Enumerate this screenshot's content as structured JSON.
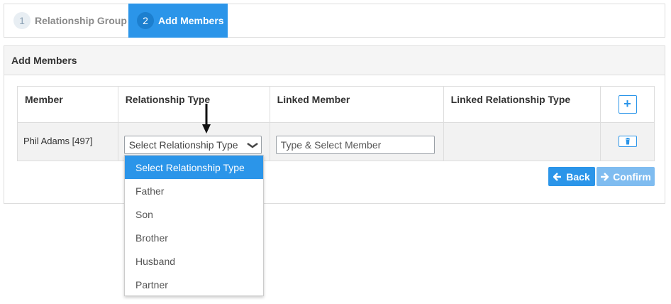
{
  "stepper": {
    "steps": [
      {
        "number": "1",
        "label": "Relationship Group"
      },
      {
        "number": "2",
        "label": "Add Members"
      }
    ]
  },
  "panel": {
    "title": "Add Members"
  },
  "table": {
    "headers": {
      "member": "Member",
      "relationship_type": "Relationship Type",
      "linked_member": "Linked Member",
      "linked_relationship_type": "Linked Relationship Type"
    },
    "rows": [
      {
        "member": "Phil Adams [497]",
        "relationship_select": "Select Relationship Type",
        "linked_member_placeholder": "Type & Select Member"
      }
    ],
    "add_label": "+"
  },
  "actions": {
    "back_label": "Back",
    "confirm_label": "Confirm"
  },
  "dropdown": {
    "options": [
      "Select Relationship Type",
      "Father",
      "Son",
      "Brother",
      "Husband",
      "Partner"
    ],
    "selected_index": 0
  },
  "colors": {
    "primary": "#2b95e9",
    "primary_disabled": "#7fbcf0"
  },
  "icons": {
    "back": "arrow-left-icon",
    "confirm": "arrow-right-icon",
    "delete": "trash-icon",
    "add": "plus-icon",
    "select": "chevron-down-icon"
  }
}
